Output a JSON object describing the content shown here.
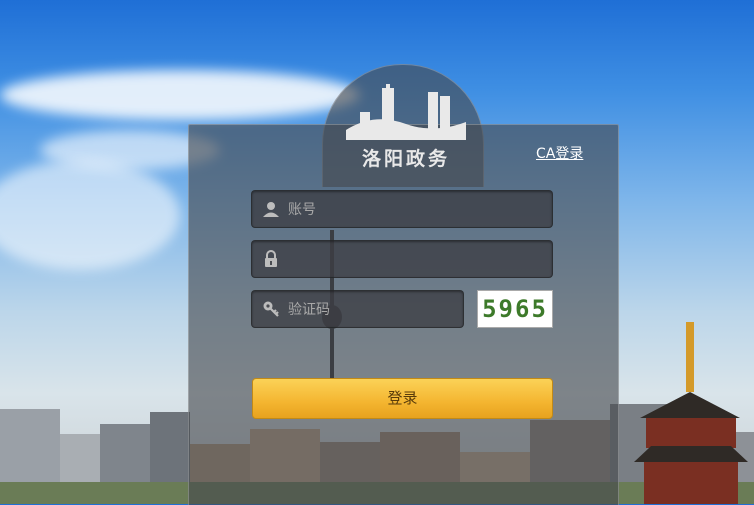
{
  "brand": {
    "title": "洛阳政务"
  },
  "ca_login": "CA登录",
  "form": {
    "account_placeholder": "账号",
    "password_placeholder": "",
    "captcha_placeholder": "验证码",
    "captcha_code": "5965",
    "login_label": "登录"
  },
  "colors": {
    "button": "#f4b530",
    "captcha_text": "#3d7a2a"
  },
  "icons": [
    "user-icon",
    "lock-icon",
    "key-icon"
  ]
}
